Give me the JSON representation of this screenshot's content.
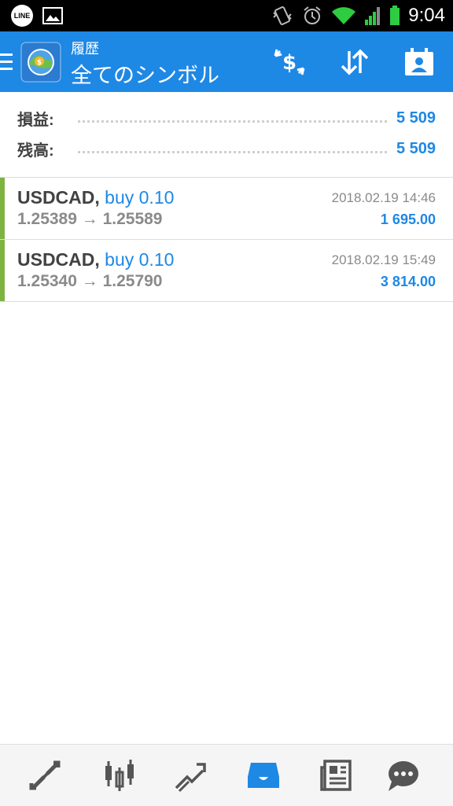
{
  "status_bar": {
    "time": "9:04",
    "line_badge": "LINE",
    "icons": [
      "line-app-icon",
      "gallery-icon",
      "vibrate-icon",
      "alarm-icon",
      "wifi-icon",
      "signal-icon",
      "battery-icon"
    ]
  },
  "app_bar": {
    "subtitle": "履歴",
    "title": "全てのシンボル",
    "actions": [
      "currency-exchange-icon",
      "sort-icon",
      "report-icon"
    ]
  },
  "summary": {
    "profit_label": "損益:",
    "profit_value": "5 509",
    "balance_label": "残高:",
    "balance_value": "5 509"
  },
  "trades": [
    {
      "symbol": "USDCAD,",
      "type": "buy 0.10",
      "prices": "1.25389 → 1.25589",
      "time": "2018.02.19 14:46",
      "profit": "1 695.00"
    },
    {
      "symbol": "USDCAD,",
      "type": "buy 0.10",
      "prices": "1.25340 → 1.25790",
      "time": "2018.02.19 15:49",
      "profit": "3 814.00"
    }
  ],
  "bottom_nav": {
    "items": [
      "trade-icon",
      "chart-icon",
      "trend-icon",
      "history-icon",
      "news-icon",
      "chat-icon"
    ],
    "active": "history-icon"
  },
  "colors": {
    "accent": "#1e88e5",
    "buy_marker": "#7cb342",
    "text_dark": "#424242",
    "text_gray": "#8a8a8a"
  }
}
